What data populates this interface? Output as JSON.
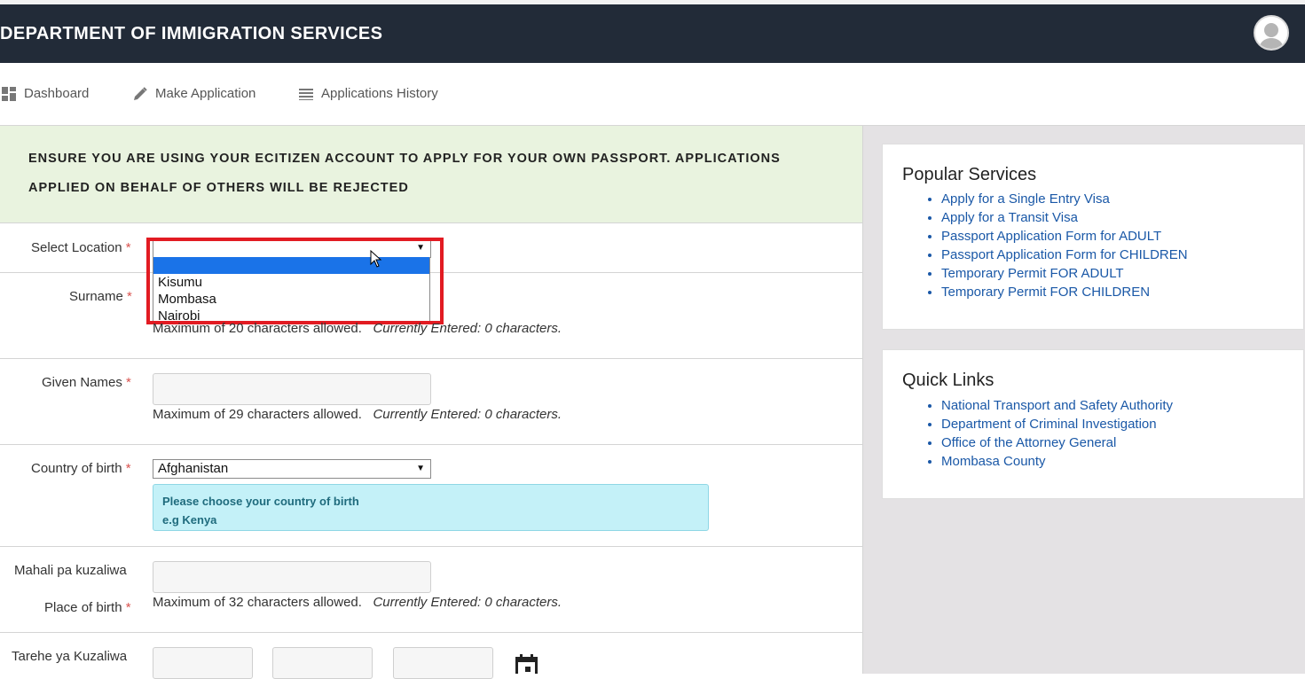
{
  "header": {
    "title": "DEPARTMENT OF IMMIGRATION SERVICES"
  },
  "nav": {
    "items": [
      {
        "label": "Dashboard",
        "icon": "dashboard-icon"
      },
      {
        "label": "Make Application",
        "icon": "pencil-icon"
      },
      {
        "label": "Applications History",
        "icon": "list-icon"
      }
    ]
  },
  "notice": {
    "line1": "ENSURE YOU ARE USING YOUR ECITIZEN ACCOUNT TO APPLY FOR YOUR OWN PASSPORT. APPLICATIONS",
    "line2": "APPLIED ON BEHALF OF OTHERS WILL BE REJECTED"
  },
  "form": {
    "location": {
      "label": "Select Location",
      "required_mark": "*",
      "value": "",
      "options": [
        "",
        "Kisumu",
        "Mombasa",
        "Nairobi"
      ]
    },
    "surname": {
      "label": "Surname",
      "required_mark": "*",
      "value": "",
      "hint_max": "Maximum of 20 characters allowed.",
      "hint_current_label": "Currently Entered:",
      "hint_current_value": "0 characters."
    },
    "given_names": {
      "label": "Given Names",
      "required_mark": "*",
      "value": "",
      "hint_max": "Maximum of 29 characters allowed.",
      "hint_current_label": "Currently Entered:",
      "hint_current_value": "0 characters."
    },
    "country_of_birth": {
      "label": "Country of birth",
      "required_mark": "*",
      "value": "Afghanistan",
      "info_line1": "Please choose your country of birth",
      "info_line2": "e.g Kenya"
    },
    "place_of_birth": {
      "label_sw": "Mahali pa kuzaliwa",
      "label_en": "Place of birth",
      "required_mark": "*",
      "value": "",
      "hint_max": "Maximum of 32 characters allowed.",
      "hint_current_label": "Currently Entered:",
      "hint_current_value": "0 characters."
    },
    "date_of_birth": {
      "label_sw": "Tarehe ya Kuzaliwa",
      "icon": "calendar-icon"
    }
  },
  "popular_services": {
    "title": "Popular Services",
    "links": [
      "Apply for a Single Entry Visa",
      "Apply for a Transit Visa",
      "Passport Application Form for ADULT",
      "Passport Application Form for CHILDREN",
      "Temporary Permit FOR ADULT",
      "Temporary Permit FOR CHILDREN"
    ]
  },
  "quick_links": {
    "title": "Quick Links",
    "links": [
      "National Transport and Safety Authority",
      "Department of Criminal Investigation",
      "Office of the Attorney General",
      "Mombasa County"
    ]
  },
  "colors": {
    "header_bg": "#222b38",
    "notice_bg": "#e9f3df",
    "info_bg": "#c4f1f8",
    "link": "#1a58a7",
    "highlight": "#e21b22",
    "selected_option": "#1a73e8",
    "sidebar_bg": "#e4e2e4"
  }
}
